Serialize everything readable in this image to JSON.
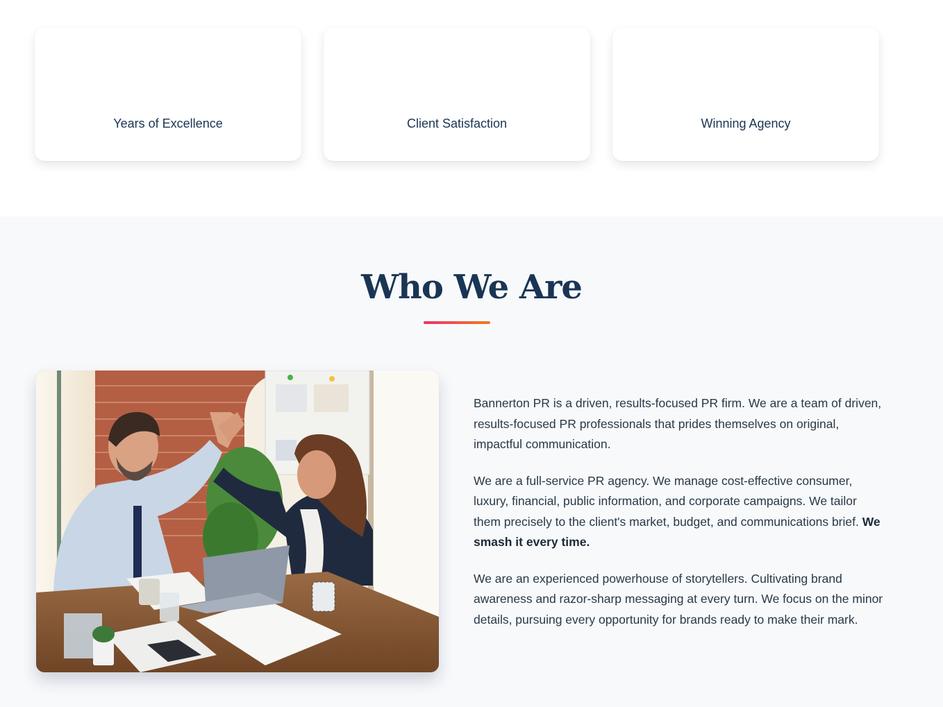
{
  "stats": {
    "cards": [
      {
        "label": "Years of Excellence"
      },
      {
        "label": "Client Satisfaction"
      },
      {
        "label": "Winning Agency"
      }
    ]
  },
  "who_we_are": {
    "title": "Who We Are",
    "paragraphs": [
      {
        "text": "Bannerton PR is a driven, results-focused PR firm. We are a team of driven, results-focused PR professionals that prides themselves on original, impactful communication."
      },
      {
        "text": "We are a full-service PR agency. We manage cost-effective consumer, luxury, financial, public information, and corporate campaigns. We tailor them precisely to the client's market, budget, and communications brief. ",
        "emphasis": "We smash it every time."
      },
      {
        "text": "We are an experienced powerhouse of storytellers. Cultivating brand awareness and razor-sharp messaging at every turn. We focus on the minor details, pursuing every opportunity for brands ready to make their mark."
      }
    ]
  },
  "colors": {
    "heading": "#1a3554",
    "body_text": "#2a3947",
    "section_bg": "#f7f9fb",
    "accent_gradient_start": "#e8336d",
    "accent_gradient_end": "#f07a21"
  }
}
